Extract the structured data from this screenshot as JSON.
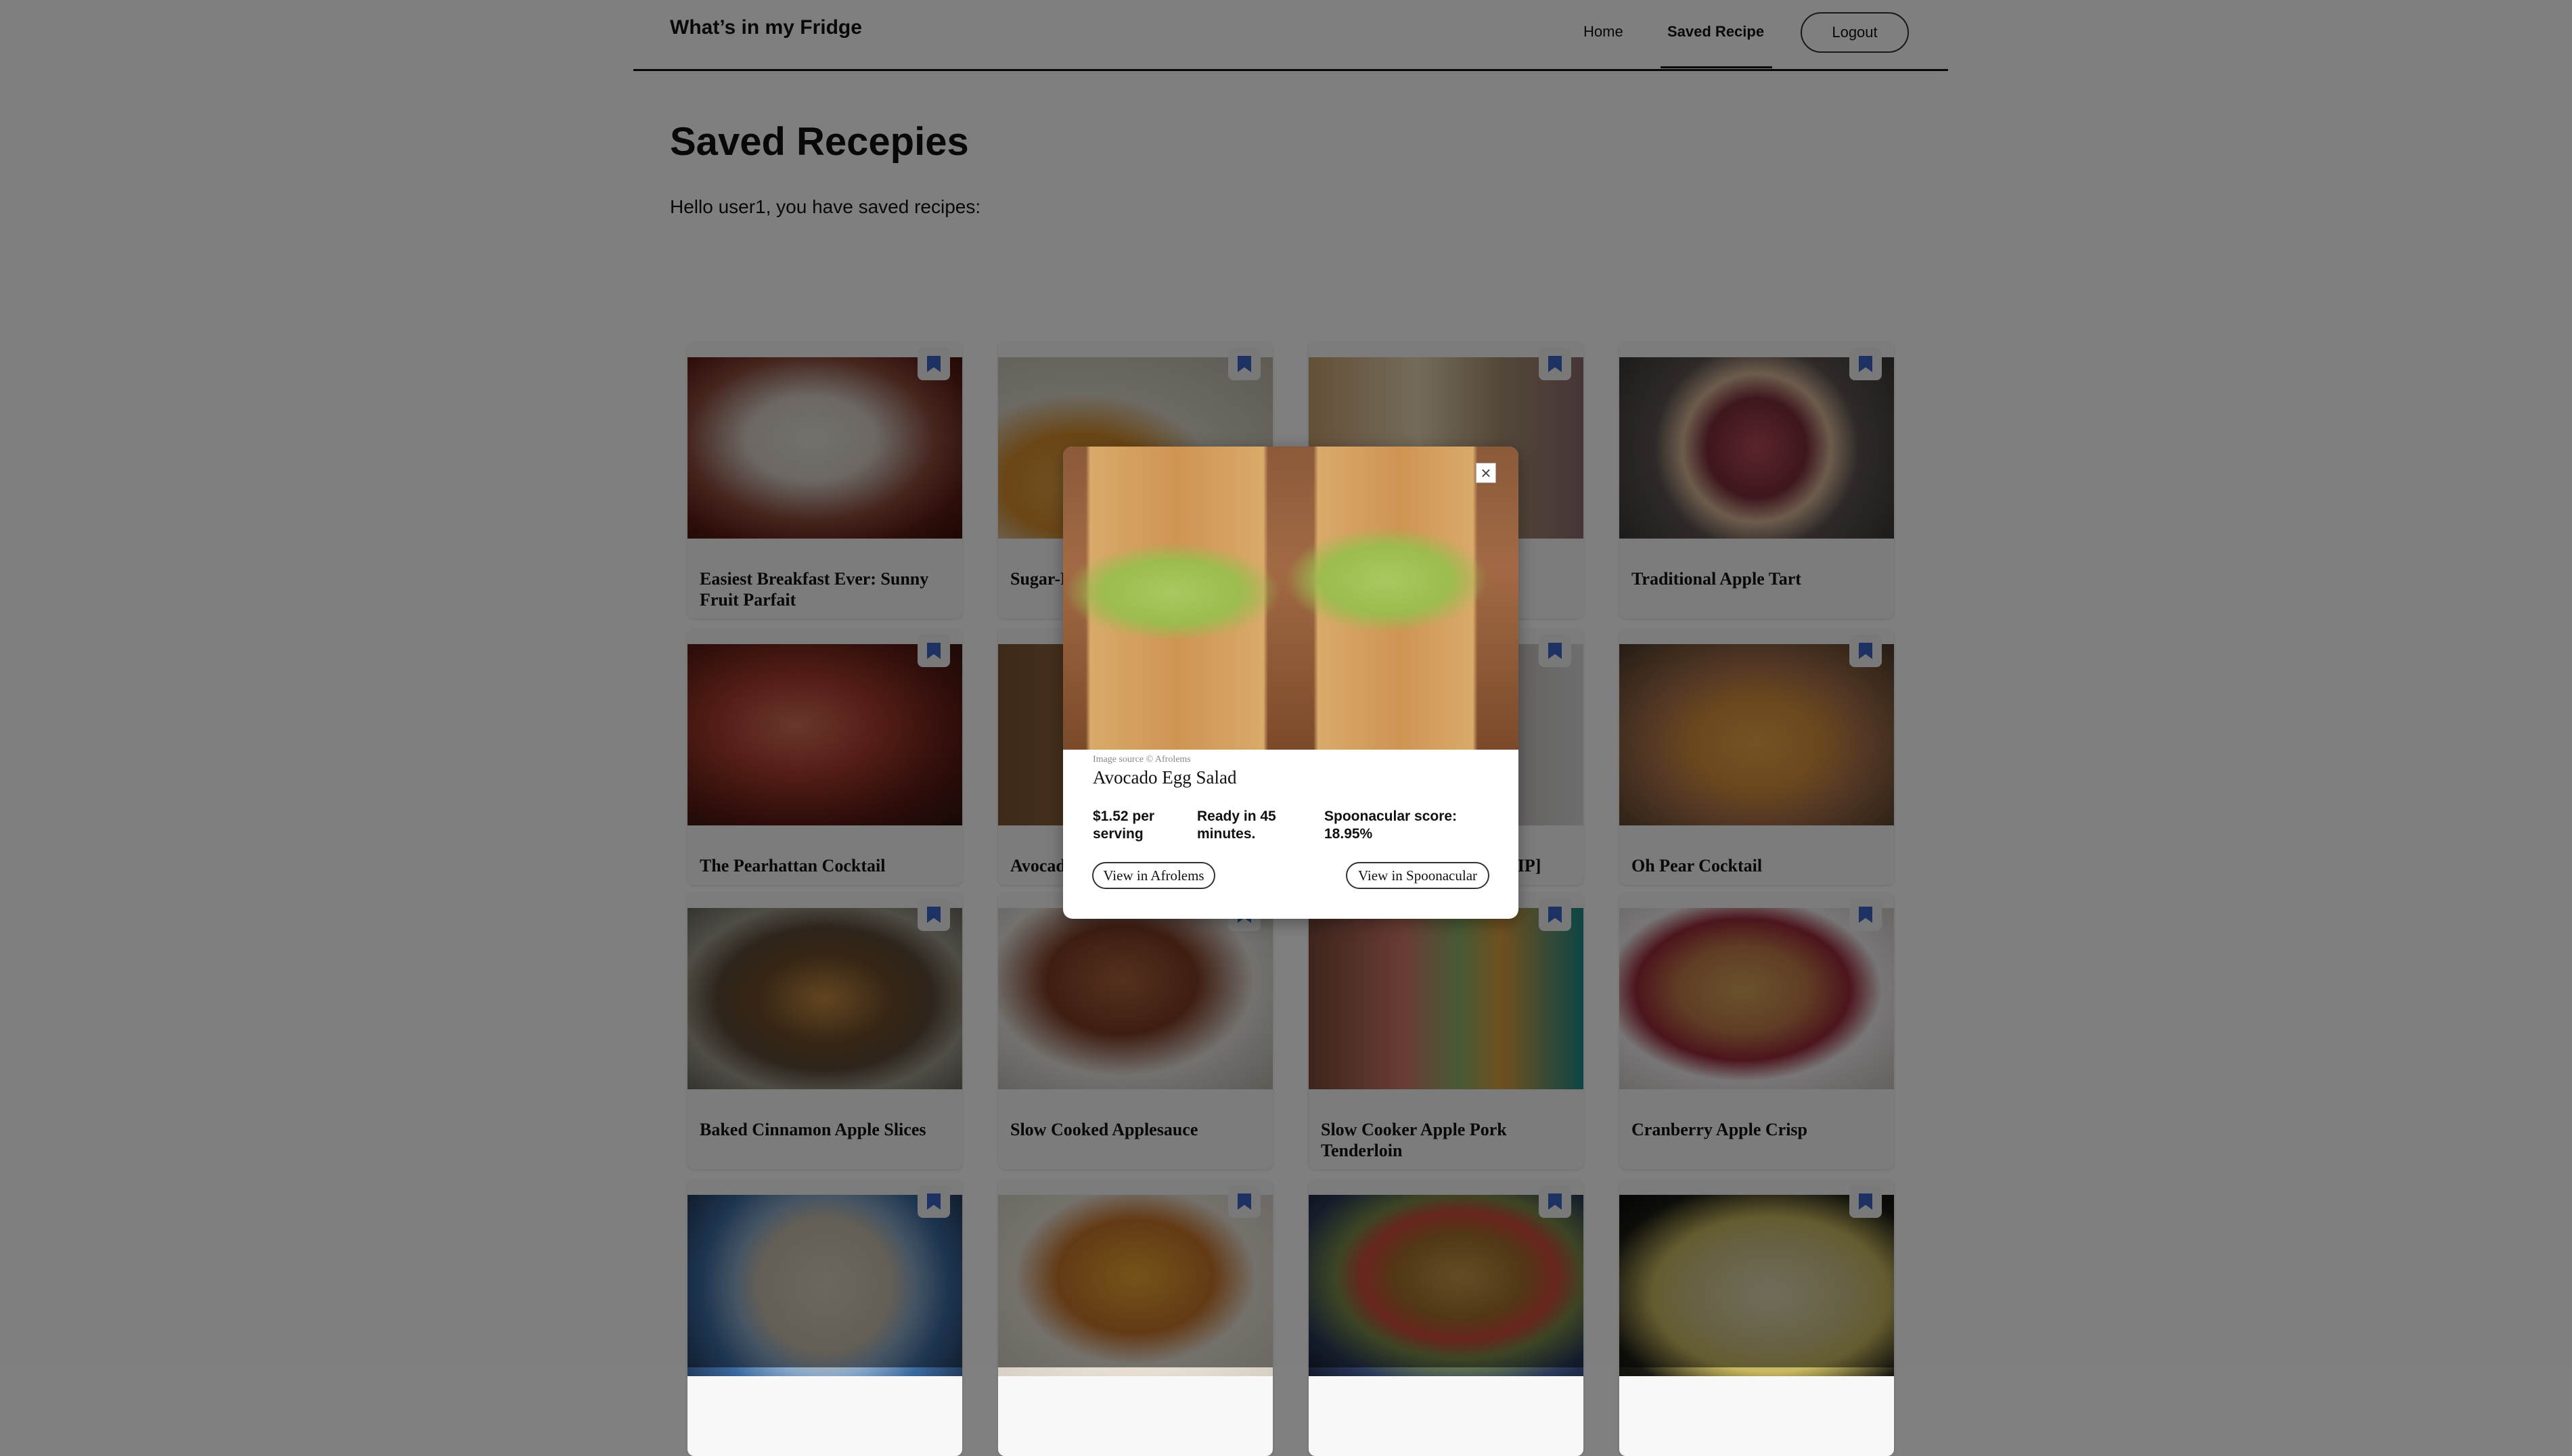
{
  "header": {
    "brand": "What’s in my Fridge",
    "nav": {
      "home": "Home",
      "saved": "Saved Recipe",
      "logout": "Logout"
    }
  },
  "main": {
    "title": "Saved Recepies",
    "greeting": "Hello user1, you have saved recipes:"
  },
  "cards": [
    {
      "title": "Easiest Breakfast Ever: Sunny Fruit Parfait"
    },
    {
      "title": "Sugar-Free Cinnamon"
    },
    {
      "title": ""
    },
    {
      "title": "Traditional Apple Tart"
    },
    {
      "title": "The Pearhattan Cocktail"
    },
    {
      "title": "Avocado Egg Salad"
    },
    {
      "title": "AIP]"
    },
    {
      "title": "Oh Pear Cocktail"
    },
    {
      "title": "Baked Cinnamon Apple Slices"
    },
    {
      "title": "Slow Cooked Applesauce"
    },
    {
      "title": "Slow Cooker Apple Pork Tenderloin"
    },
    {
      "title": "Cranberry Apple Crisp"
    },
    {
      "title": ""
    },
    {
      "title": ""
    },
    {
      "title": ""
    },
    {
      "title": ""
    }
  ],
  "modal": {
    "image_credit": "Image source © Afrolems",
    "title": "Avocado Egg Salad",
    "price": "$1.52 per serving",
    "ready": "Ready in 45 minutes.",
    "score": "Spoonacular score: 18.95%",
    "view_source": "View in Afrolems",
    "view_spoonacular": "View in Spoonacular",
    "close_symbol": "×"
  },
  "colors": {
    "bookmark": "#3b63c4",
    "overlay": "rgba(0,0,0,0.5)"
  },
  "icons": {
    "bookmark": "bookmark-icon",
    "close": "close-icon"
  }
}
